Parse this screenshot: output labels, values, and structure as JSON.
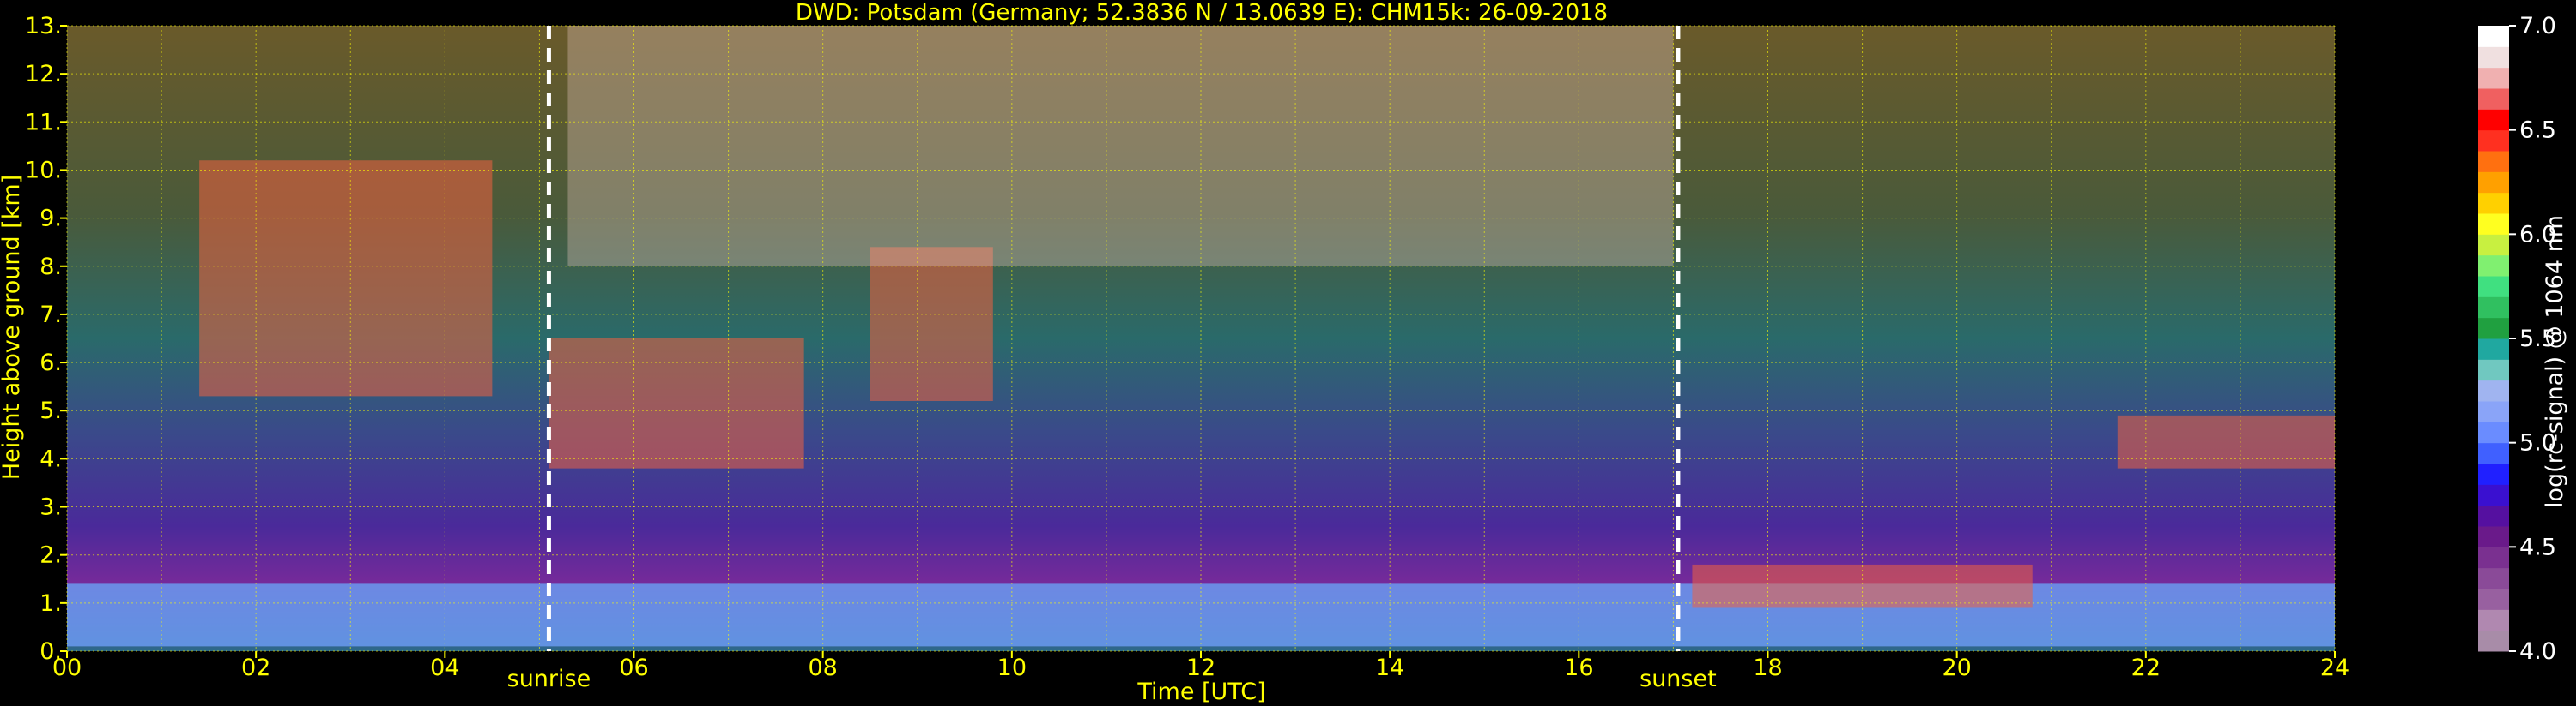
{
  "chart_data": {
    "type": "heatmap",
    "title": "DWD: Potsdam (Germany; 52.3836 N / 13.0639 E):    CHM15k: 26-09-2018",
    "xlabel": "Time [UTC]",
    "ylabel": "Height above ground [km]",
    "x_range": [
      0,
      24
    ],
    "y_range": [
      0,
      13
    ],
    "x_ticks": [
      "00",
      "02",
      "04",
      "06",
      "08",
      "10",
      "12",
      "14",
      "16",
      "18",
      "20",
      "22",
      "24"
    ],
    "y_ticks": [
      "0.",
      "1.",
      "2.",
      "3.",
      "4.",
      "5.",
      "6.",
      "7.",
      "8.",
      "9.",
      "10.",
      "11.",
      "12.",
      "13."
    ],
    "grid": true,
    "markers": [
      {
        "label": "sunrise",
        "time": 5.1
      },
      {
        "label": "sunset",
        "time": 17.05
      }
    ],
    "colorbar": {
      "label": "log(rc-signal) @ 1064 nm",
      "range": [
        4.0,
        7.0
      ],
      "ticks": [
        "4.0",
        "4.5",
        "5.0",
        "5.5",
        "6.0",
        "6.5",
        "7.0"
      ],
      "colors": [
        "#a88ca8",
        "#b088b0",
        "#9860a0",
        "#8a4a98",
        "#7a3090",
        "#6a1a8a",
        "#5510a0",
        "#3a10d0",
        "#2020ff",
        "#4060ff",
        "#6a8cff",
        "#8aa4f8",
        "#a0b4f0",
        "#70c8c0",
        "#20a8a0",
        "#20a040",
        "#30c060",
        "#40e080",
        "#80f070",
        "#c8f040",
        "#ffff20",
        "#ffd000",
        "#ffa000",
        "#ff7010",
        "#ff3020",
        "#ff0000",
        "#f06060",
        "#f0b0b0",
        "#f0e0e0",
        "#ffffff"
      ]
    },
    "features": [
      {
        "kind": "boundary_layer",
        "t_start": 0,
        "t_end": 24,
        "h_bottom": 0.1,
        "h_top": 1.4
      },
      {
        "kind": "cloud_layer",
        "t_start": 1.4,
        "t_end": 4.5,
        "h_bottom": 5.3,
        "h_top": 10.2
      },
      {
        "kind": "cloud_layer",
        "t_start": 5.1,
        "t_end": 7.8,
        "h_bottom": 3.8,
        "h_top": 6.5
      },
      {
        "kind": "cloud_layer",
        "t_start": 8.5,
        "t_end": 9.8,
        "h_bottom": 5.2,
        "h_top": 8.4
      },
      {
        "kind": "cirrus",
        "t_start": 5.3,
        "t_end": 17.0,
        "h_bottom": 8.0,
        "h_top": 13.0
      },
      {
        "kind": "cloud_layer",
        "t_start": 17.2,
        "t_end": 20.8,
        "h_bottom": 0.9,
        "h_top": 1.8
      },
      {
        "kind": "cloud_layer",
        "t_start": 21.7,
        "t_end": 24.0,
        "h_bottom": 3.8,
        "h_top": 4.9
      }
    ]
  }
}
